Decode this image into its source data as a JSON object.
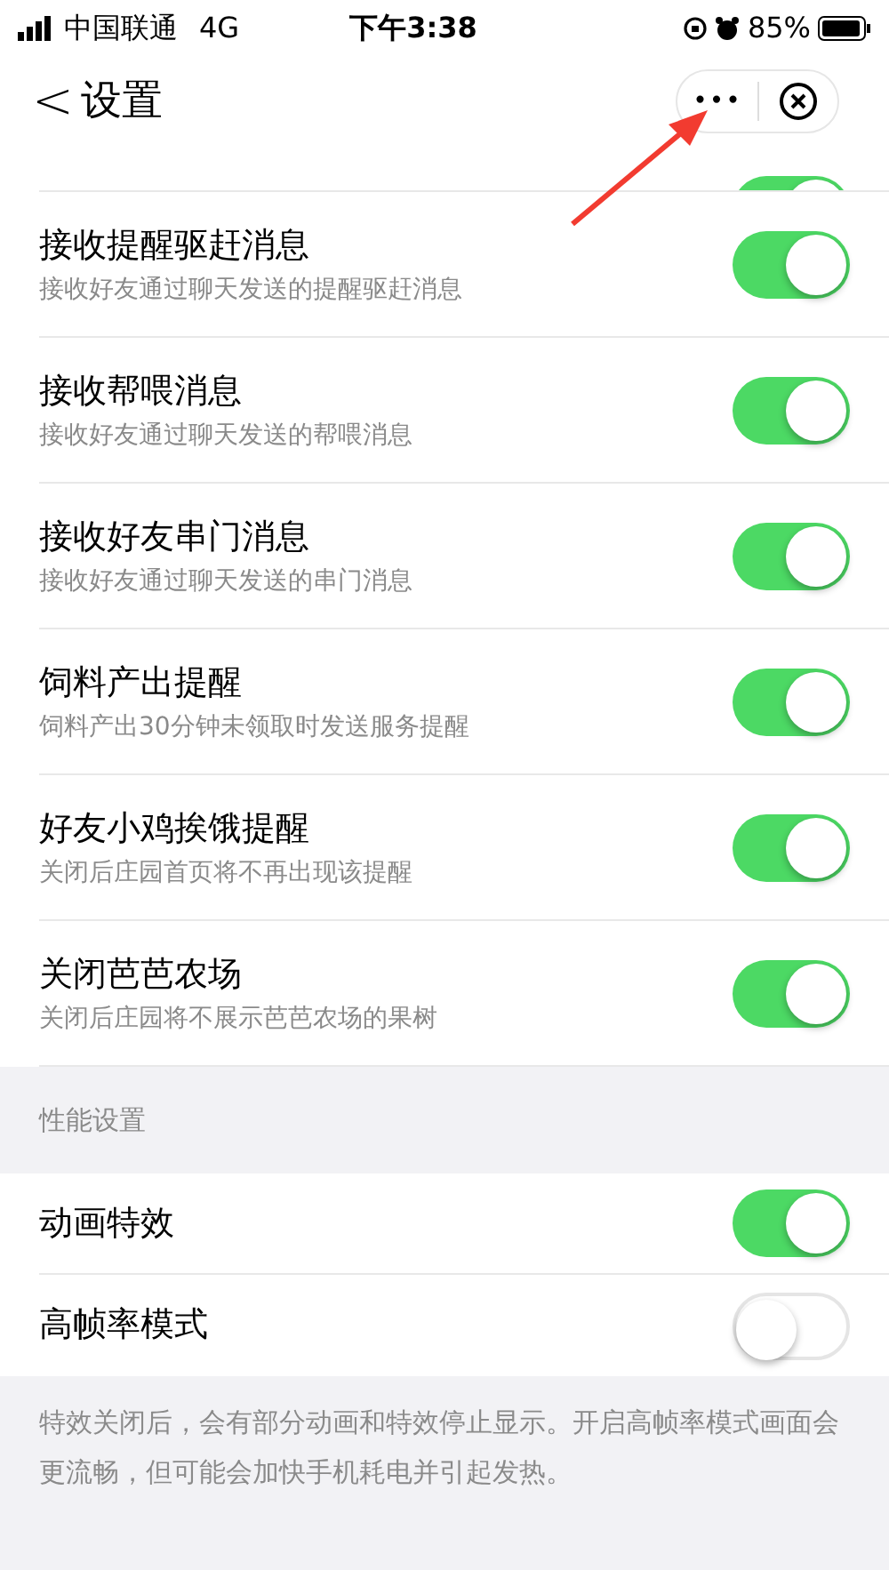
{
  "status_bar": {
    "carrier": "中国联通",
    "network": "4G",
    "time": "下午3:38",
    "battery": "85%"
  },
  "nav": {
    "back": "<",
    "title": "设置",
    "more": "•••"
  },
  "clipped_row": {
    "on": true
  },
  "settings": [
    {
      "title": "接收提醒驱赶消息",
      "subtitle": "接收好友通过聊天发送的提醒驱赶消息",
      "on": true
    },
    {
      "title": "接收帮喂消息",
      "subtitle": "接收好友通过聊天发送的帮喂消息",
      "on": true
    },
    {
      "title": "接收好友串门消息",
      "subtitle": "接收好友通过聊天发送的串门消息",
      "on": true
    },
    {
      "title": "饲料产出提醒",
      "subtitle": "饲料产出30分钟未领取时发送服务提醒",
      "on": true
    },
    {
      "title": "好友小鸡挨饿提醒",
      "subtitle": "关闭后庄园首页将不再出现该提醒",
      "on": true
    },
    {
      "title": "关闭芭芭农场",
      "subtitle": "关闭后庄园将不展示芭芭农场的果树",
      "on": true
    }
  ],
  "performance": {
    "header": "性能设置",
    "items": [
      {
        "title": "动画特效",
        "on": true
      },
      {
        "title": "高帧率模式",
        "on": false
      }
    ],
    "note": "特效关闭后，会有部分动画和特效停止显示。开启高帧率模式画面会更流畅，但可能会加快手机耗电并引起发热。"
  }
}
